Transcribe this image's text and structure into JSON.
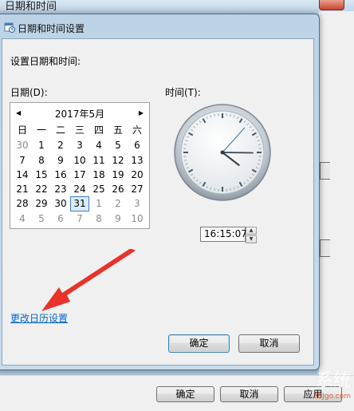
{
  "background_window": {
    "title": "日期和时间",
    "buttons": {
      "ok": "确定",
      "cancel": "取消",
      "apply": "应用"
    }
  },
  "dialog": {
    "title": "日期和时间设置",
    "heading": "设置日期和时间:",
    "date_label": "日期(D):",
    "time_label": "时间(T):",
    "calendar": {
      "month_title": "2017年5月",
      "weekdays": [
        "日",
        "一",
        "二",
        "三",
        "四",
        "五",
        "六"
      ],
      "weeks": [
        [
          "30",
          "1",
          "2",
          "3",
          "4",
          "5",
          "6"
        ],
        [
          "7",
          "8",
          "9",
          "10",
          "11",
          "12",
          "13"
        ],
        [
          "14",
          "15",
          "16",
          "17",
          "18",
          "19",
          "20"
        ],
        [
          "21",
          "22",
          "23",
          "24",
          "25",
          "26",
          "27"
        ],
        [
          "28",
          "29",
          "30",
          "31",
          "1",
          "2",
          "3"
        ],
        [
          "4",
          "5",
          "6",
          "7",
          "8",
          "9",
          "10"
        ]
      ],
      "selected_day": "31"
    },
    "clock": {
      "hour": 16,
      "minute": 15,
      "second": 7
    },
    "time_value": "16:15:07",
    "change_calendar_link": "更改日历设置",
    "ok_button": "确定",
    "cancel_button": "取消"
  },
  "watermark": {
    "text": "系统",
    "site": "58Jgo.com"
  },
  "colors": {
    "link": "#0066cc",
    "selection_border": "#3b7fc4",
    "arrow": "#e8322a"
  }
}
